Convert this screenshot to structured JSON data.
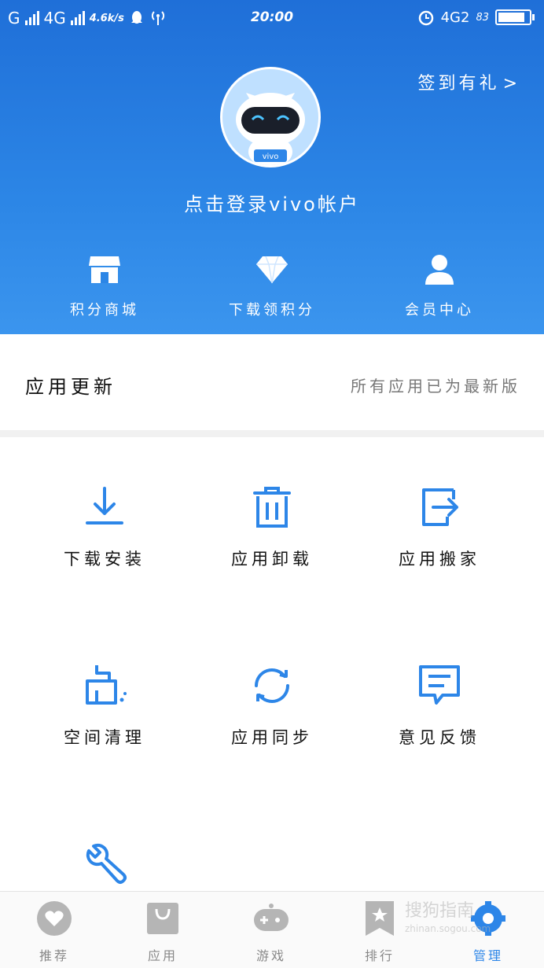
{
  "status_bar": {
    "carrier1": "G",
    "carrier2": "4G",
    "speed": "4.6k/s",
    "time": "20:00",
    "network_right": "4G2",
    "battery_percent": "83"
  },
  "header": {
    "checkin_label": "签到有礼",
    "checkin_chevron": ">",
    "login_prompt": "点击登录vivo帐户",
    "avatar_badge": "vivo",
    "quick_links": [
      {
        "label": "积分商城",
        "icon": "store-icon"
      },
      {
        "label": "下载领积分",
        "icon": "diamond-icon"
      },
      {
        "label": "会员中心",
        "icon": "person-icon"
      }
    ]
  },
  "updates": {
    "title": "应用更新",
    "status": "所有应用已为最新版"
  },
  "tools": [
    {
      "label": "下载安装",
      "icon": "download-icon"
    },
    {
      "label": "应用卸载",
      "icon": "trash-icon"
    },
    {
      "label": "应用搬家",
      "icon": "move-out-icon"
    },
    {
      "label": "空间清理",
      "icon": "broom-icon"
    },
    {
      "label": "应用同步",
      "icon": "sync-icon"
    },
    {
      "label": "意见反馈",
      "icon": "feedback-icon"
    },
    {
      "label": "设置",
      "icon": "wrench-icon"
    }
  ],
  "bottom_nav": [
    {
      "label": "推荐",
      "icon": "heart-icon"
    },
    {
      "label": "应用",
      "icon": "bag-icon"
    },
    {
      "label": "游戏",
      "icon": "gamepad-icon"
    },
    {
      "label": "排行",
      "icon": "ranking-icon"
    },
    {
      "label": "管理",
      "icon": "manage-icon",
      "active": true
    }
  ],
  "watermark": {
    "text": "搜狗指南",
    "url": "zhinan.sogou.com"
  },
  "colors": {
    "accent": "#2d86e8",
    "header_top": "#1f6fd8",
    "header_bottom": "#3b95ee"
  }
}
